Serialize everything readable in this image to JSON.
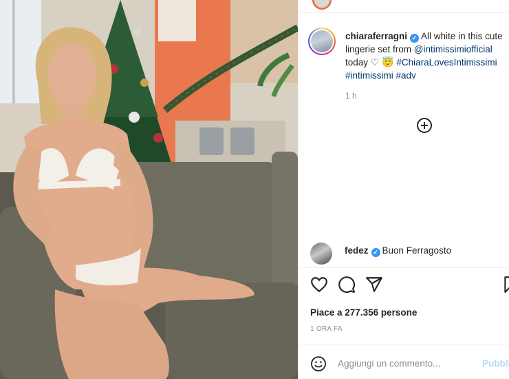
{
  "post": {
    "author": "chiaraferragni",
    "caption_part1": "All white in this cute lingerie set from ",
    "caption_mention": "@intimissimiofficial",
    "caption_part2": " today ",
    "caption_emoji_heart": "♡",
    "caption_emoji_face": "😇",
    "caption_hashtag1": "#ChiaraLovesIntimissimi",
    "caption_hashtag2": "#intimissimi",
    "caption_hashtag3": "#adv",
    "caption_time": "1 h",
    "load_more_icon": "plus-circle-icon"
  },
  "comments": [
    {
      "author": "fedez",
      "text": "Buon Ferragosto"
    }
  ],
  "actions": {
    "like_icon": "heart-icon",
    "comment_icon": "comment-icon",
    "share_icon": "send-icon",
    "save_icon": "bookmark-icon"
  },
  "likes_text": "Piace a 277.356 persone",
  "post_date": "1 ORA FA",
  "add_comment": {
    "emoji_icon": "smiley-icon",
    "placeholder": "Aggiungi un commento...",
    "publish_label": "Pubblica"
  },
  "colors": {
    "verified_blue": "#3897f0",
    "link_blue": "#00376b",
    "publish_disabled": "#b3dbff",
    "muted_gray": "#8e8e8e"
  }
}
